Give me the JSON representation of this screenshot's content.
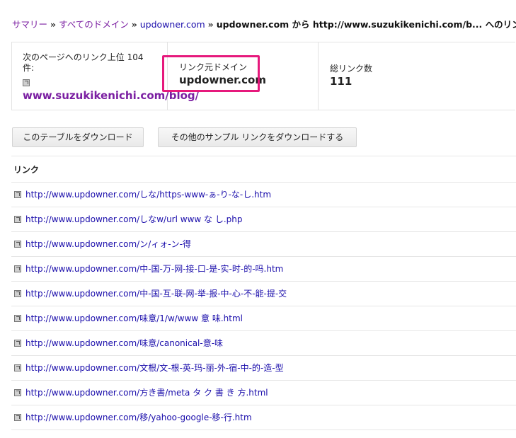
{
  "breadcrumb": {
    "summary": "サマリー",
    "sep1": "»",
    "all_domains": "すべてのドメイン",
    "sep2": "»",
    "domain": "updowner.com",
    "sep3": "»",
    "current": "updowner.com から http://www.suzukikenichi.com/b... へのリンク"
  },
  "stats": {
    "top_page_label": "次のページへのリンク上位 104 件:",
    "top_page_link": "www.suzukikenichi.com/blog/",
    "source_domain_label": "リンク元ドメイン",
    "source_domain_value": "updowner.com",
    "total_links_label": "総リンク数",
    "total_links_value": "111"
  },
  "buttons": {
    "download_table": "このテーブルをダウンロード",
    "download_sample": "その他のサンプル リンクをダウンロードする"
  },
  "table": {
    "header": "リンク",
    "rows": [
      "http://www.updowner.com/しな/https-www-ぁ-り-な-し.htm",
      "http://www.updowner.com/しなw/url www な し.php",
      "http://www.updowner.com/ン/ィォ-ン-得",
      "http://www.updowner.com/中-国-万-网-接-口-是-实-时-的-吗.htm",
      "http://www.updowner.com/中-国-互-联-网-举-报-中-心-不-能-提-交",
      "http://www.updowner.com/味意/1/w/www 意 味.html",
      "http://www.updowner.com/味意/canonical-意-味",
      "http://www.updowner.com/文根/文-根-英-玛-丽-外-宿-中-的-造-型",
      "http://www.updowner.com/方き書/meta タ ク 書 き 方.html",
      "http://www.updowner.com/移/yahoo-google-移-行.htm"
    ]
  },
  "colors": {
    "visited_link": "#7b1fa2",
    "link": "#1a0dab",
    "highlight_box": "#e6197c"
  }
}
